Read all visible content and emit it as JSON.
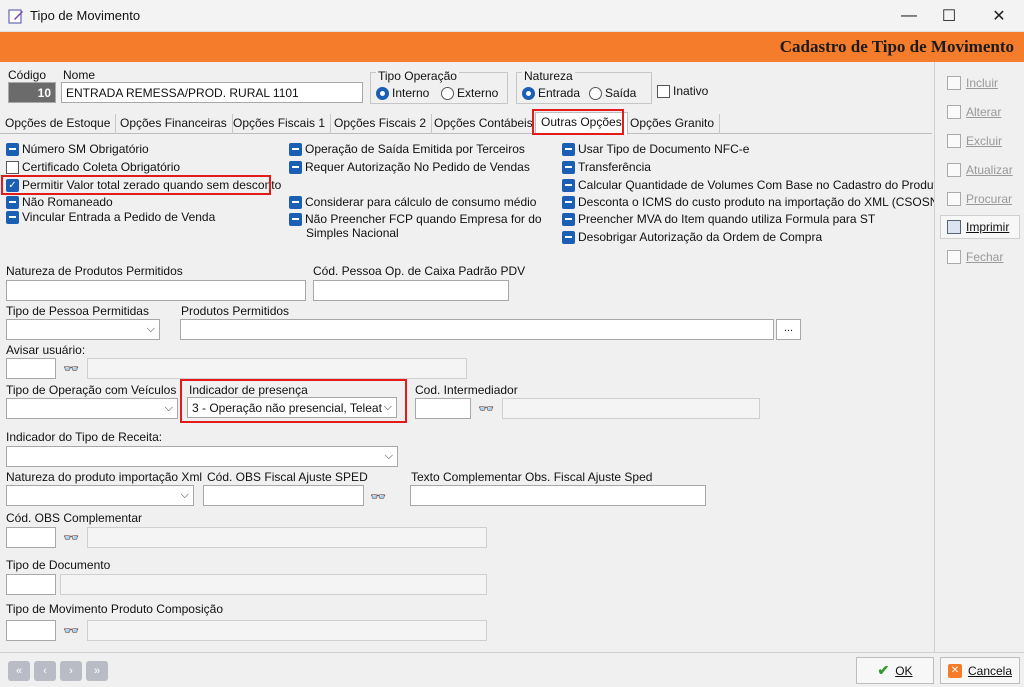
{
  "window": {
    "title": "Tipo de Movimento",
    "header": "Cadastro de Tipo de Movimento",
    "minimize": "—",
    "maximize": "☐",
    "close": "✕"
  },
  "form": {
    "codigo_label": "Código",
    "codigo_value": "10",
    "nome_label": "Nome",
    "nome_value": "ENTRADA REMESSA/PROD. RURAL 1101",
    "tipo_operacao_label": "Tipo Operação",
    "interno": "Interno",
    "externo": "Externo",
    "natureza_label": "Natureza",
    "entrada": "Entrada",
    "saida": "Saída",
    "inativo": "Inativo"
  },
  "tabs": [
    "Opções de Estoque",
    "Opções Financeiras",
    "Opções Fiscais 1",
    "Opções Fiscais 2",
    "Opções Contábeis",
    "Outras Opções",
    "Opções Granito"
  ],
  "options_col1": [
    "Número SM Obrigatório",
    "Certificado Coleta Obrigatório",
    "Permitir Valor total zerado quando sem desconto",
    "Não Romaneado",
    "Vincular Entrada a Pedido de Venda"
  ],
  "options_col2": [
    "Operação de Saída Emitida por Terceiros",
    "Requer Autorização No Pedido de Vendas",
    "Considerar para cálculo de consumo médio",
    "Não Preencher FCP quando Empresa for do",
    "Simples Nacional"
  ],
  "options_col3": [
    "Usar Tipo de Documento NFC-e",
    "Transferência",
    "Calcular Quantidade de Volumes Com Base no Cadastro do Produto",
    "Desconta o ICMS do custo produto na importação do XML (CSOSN)",
    "Preencher MVA do Item quando utiliza Formula para ST",
    "Desobrigar Autorização da Ordem de Compra"
  ],
  "fields": {
    "natureza_produtos": "Natureza de Produtos Permitidos",
    "cod_pessoa_caixa": "Cód. Pessoa Op. de Caixa Padrão PDV",
    "tipo_pessoa": "Tipo de Pessoa Permitidas",
    "produtos_permitidos": "Produtos Permitidos",
    "ellipsis": "...",
    "avisar_usuario": "Avisar usuário:",
    "tipo_op_veiculos": "Tipo de Operação com Veículos",
    "indicador_presenca": "Indicador de presença",
    "indicador_presenca_value": "3 - Operação não presencial, Teleat",
    "cod_intermediador": "Cod. Intermediador",
    "indicador_receita": "Indicador do Tipo de Receita:",
    "natureza_import": "Natureza do produto importação Xml",
    "cod_obs_fiscal": "Cód. OBS Fiscal Ajuste SPED",
    "texto_complementar": "Texto Complementar Obs. Fiscal Ajuste Sped",
    "cod_obs_complementar": "Cód. OBS Complementar",
    "tipo_documento": "Tipo de Documento",
    "tipo_mov_composicao": "Tipo de Movimento Produto Composição"
  },
  "sidebar": [
    "Incluir",
    "Alterar",
    "Excluir",
    "Atualizar",
    "Procurar",
    "Imprimir",
    "Fechar"
  ],
  "footer": {
    "ok": "OK",
    "cancel": "Cancela"
  },
  "colors": {
    "accent": "#f57c2a",
    "highlight": "#e41b1b",
    "checkbox": "#1a5fb4"
  }
}
